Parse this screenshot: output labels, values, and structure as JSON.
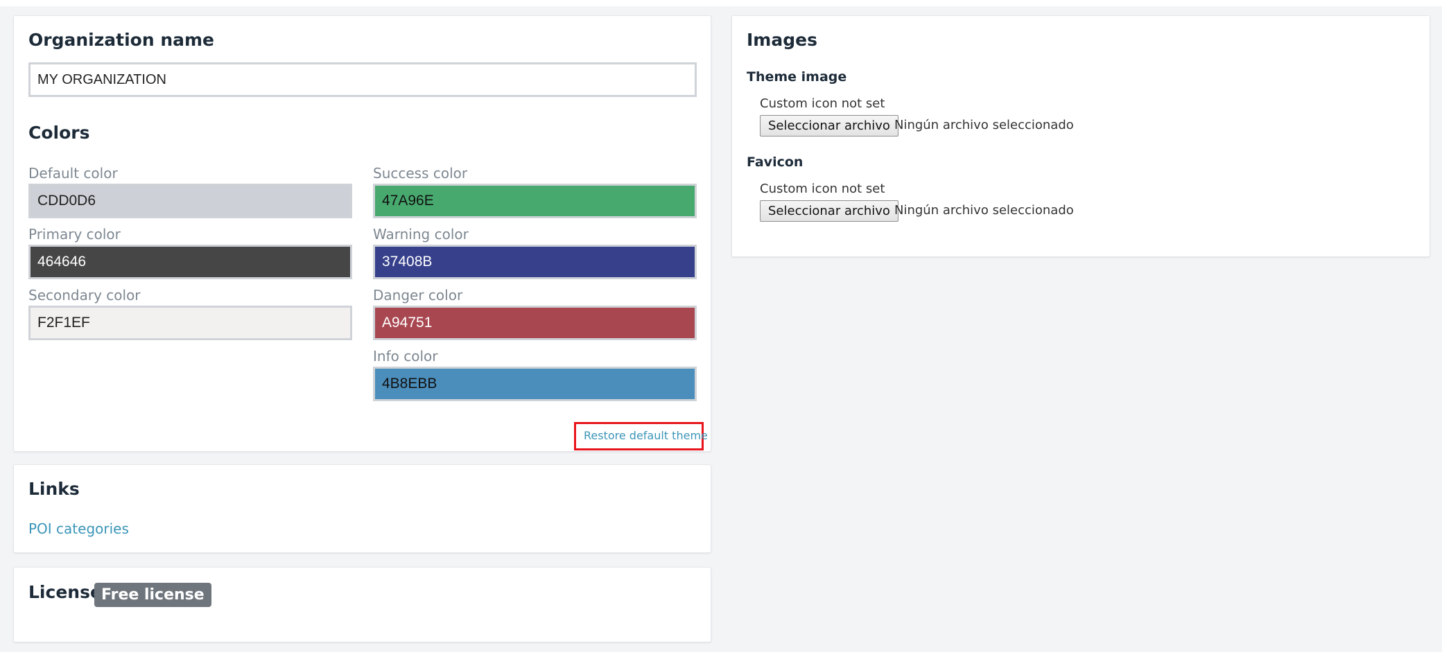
{
  "organization": {
    "title": "Organization name",
    "value": "MY ORGANIZATION"
  },
  "colors": {
    "title": "Colors",
    "default": {
      "label": "Default color",
      "value": "CDD0D6",
      "bg": "#CDD0D6",
      "fg": "#1f1f1f"
    },
    "primary": {
      "label": "Primary color",
      "value": "464646",
      "bg": "#464646",
      "fg": "#ffffff"
    },
    "secondary": {
      "label": "Secondary color",
      "value": "F2F1EF",
      "bg": "#F2F1EF",
      "fg": "#1f1f1f"
    },
    "success": {
      "label": "Success color",
      "value": "47A96E",
      "bg": "#47A96E",
      "fg": "#111111"
    },
    "warning": {
      "label": "Warning color",
      "value": "37408B",
      "bg": "#37408B",
      "fg": "#ffffff"
    },
    "danger": {
      "label": "Danger color",
      "value": "A94751",
      "bg": "#A94751",
      "fg": "#ffffff"
    },
    "info": {
      "label": "Info color",
      "value": "4B8EBB",
      "bg": "#4B8EBB",
      "fg": "#111111"
    },
    "restore_label": "Restore default theme"
  },
  "links": {
    "title": "Links",
    "poi_label": "POI categories"
  },
  "license": {
    "title": "License",
    "badge": "Free license"
  },
  "images": {
    "title": "Images",
    "theme": {
      "title": "Theme image",
      "hint": "Custom icon not set",
      "button": "Seleccionar archivo",
      "status": "Ningún archivo seleccionado"
    },
    "favicon": {
      "title": "Favicon",
      "hint": "Custom icon not set",
      "button": "Seleccionar archivo",
      "status": "Ningún archivo seleccionado"
    }
  },
  "theme": {
    "link_color": "#3b95b8",
    "highlight_color": "#e8141b",
    "badge_color": "#6f757c"
  }
}
